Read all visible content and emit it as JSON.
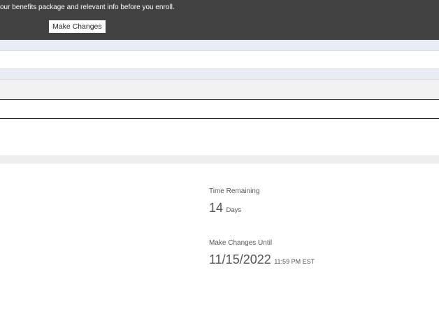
{
  "banner": {
    "text": "our benefits package and relevant info before you enroll.",
    "button_label": "Make Changes"
  },
  "enrollment": {
    "time_remaining_label": "Time Remaining",
    "time_remaining_value": "14",
    "time_remaining_unit": "Days",
    "deadline_label": "Make Changes Until",
    "deadline_date": "11/15/2022",
    "deadline_time": "11:59 PM EST"
  },
  "colors": {
    "banner_bg": "#424242",
    "text": "#555555"
  }
}
